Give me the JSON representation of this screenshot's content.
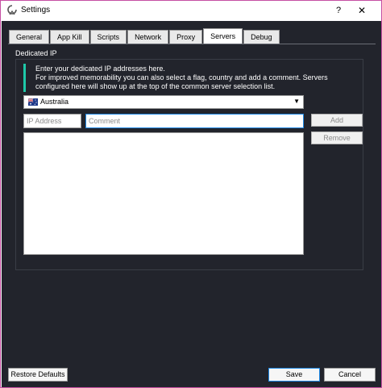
{
  "window": {
    "title": "Settings",
    "help_label": "?",
    "close_label": "✕"
  },
  "tabs": [
    {
      "label": "General",
      "active": false
    },
    {
      "label": "App Kill",
      "active": false
    },
    {
      "label": "Scripts",
      "active": false
    },
    {
      "label": "Network",
      "active": false
    },
    {
      "label": "Proxy",
      "active": false
    },
    {
      "label": "Servers",
      "active": true
    },
    {
      "label": "Debug",
      "active": false
    }
  ],
  "dedicated_ip": {
    "group_title": "Dedicated IP",
    "info_line1": "Enter your dedicated IP addresses here.",
    "info_line2": "For improved memorability you can also select a flag, country and add a comment. Servers configured here will show up at the top of the common server selection list.",
    "country": {
      "selected": "Australia",
      "flag_icon": "australia-flag-icon"
    },
    "ip_placeholder": "IP Address",
    "comment_placeholder": "Comment",
    "add_label": "Add",
    "remove_label": "Remove",
    "entries": []
  },
  "footer": {
    "restore_label": "Restore Defaults",
    "save_label": "Save",
    "cancel_label": "Cancel"
  },
  "colors": {
    "background": "#22242c",
    "accent": "#1ec8a8",
    "focus": "#1e88e5",
    "window_border": "#c64fa3"
  }
}
